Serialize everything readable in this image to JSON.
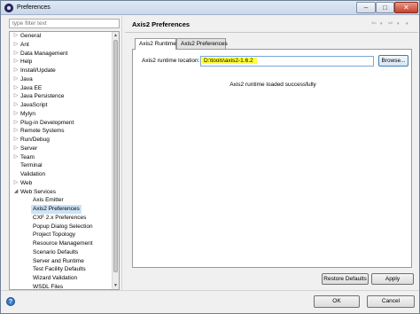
{
  "window": {
    "title": "Preferences",
    "app_icon": "eclipse-icon",
    "controls": {
      "minimize": "–",
      "maximize": "□",
      "close": "✕"
    }
  },
  "filter": {
    "placeholder": "type filter text"
  },
  "tree": {
    "items": [
      {
        "label": "General",
        "expander": "collapsed",
        "depth": 0
      },
      {
        "label": "Ant",
        "expander": "collapsed",
        "depth": 0
      },
      {
        "label": "Data Management",
        "expander": "collapsed",
        "depth": 0
      },
      {
        "label": "Help",
        "expander": "collapsed",
        "depth": 0
      },
      {
        "label": "Install/Update",
        "expander": "collapsed",
        "depth": 0
      },
      {
        "label": "Java",
        "expander": "collapsed",
        "depth": 0
      },
      {
        "label": "Java EE",
        "expander": "collapsed",
        "depth": 0
      },
      {
        "label": "Java Persistence",
        "expander": "collapsed",
        "depth": 0
      },
      {
        "label": "JavaScript",
        "expander": "collapsed",
        "depth": 0
      },
      {
        "label": "Mylyn",
        "expander": "collapsed",
        "depth": 0
      },
      {
        "label": "Plug-in Development",
        "expander": "collapsed",
        "depth": 0
      },
      {
        "label": "Remote Systems",
        "expander": "collapsed",
        "depth": 0
      },
      {
        "label": "Run/Debug",
        "expander": "collapsed",
        "depth": 0
      },
      {
        "label": "Server",
        "expander": "collapsed",
        "depth": 0
      },
      {
        "label": "Team",
        "expander": "collapsed",
        "depth": 0
      },
      {
        "label": "Terminal",
        "expander": "none",
        "depth": 0
      },
      {
        "label": "Validation",
        "expander": "none",
        "depth": 0
      },
      {
        "label": "Web",
        "expander": "collapsed",
        "depth": 0
      },
      {
        "label": "Web Services",
        "expander": "expanded",
        "depth": 0
      },
      {
        "label": "Axis Emitter",
        "expander": "none",
        "depth": 1
      },
      {
        "label": "Axis2 Preferences",
        "expander": "none",
        "depth": 1,
        "selected": true
      },
      {
        "label": "CXF 2.x Preferences",
        "expander": "none",
        "depth": 1
      },
      {
        "label": "Popup Dialog Selection",
        "expander": "none",
        "depth": 1
      },
      {
        "label": "Project Topology",
        "expander": "none",
        "depth": 1
      },
      {
        "label": "Resource Management",
        "expander": "none",
        "depth": 1
      },
      {
        "label": "Scenario Defaults",
        "expander": "none",
        "depth": 1
      },
      {
        "label": "Server and Runtime",
        "expander": "none",
        "depth": 1
      },
      {
        "label": "Test Facility Defaults",
        "expander": "none",
        "depth": 1
      },
      {
        "label": "Wizard Validation",
        "expander": "none",
        "depth": 1
      },
      {
        "label": "WSDL Files",
        "expander": "none",
        "depth": 1
      }
    ]
  },
  "page": {
    "title": "Axis2 Preferences",
    "nav": {
      "back": "⇦",
      "back_menu": "▾",
      "forward": "⇨",
      "forward_menu": "▾",
      "menu": "▾"
    },
    "tabs": [
      {
        "label": "Axis2 Runtime",
        "active": true
      },
      {
        "label": "Axis2 Preferences",
        "active": false
      }
    ],
    "runtime": {
      "location_label": "Axis2 runtime location:",
      "location_value": "D:\\tools\\axis2-1.6.2",
      "highlight_color": "#ffff3a",
      "browse_label": "Browse...",
      "status_message": "Axis2 runtime loaded successfully"
    },
    "restore_defaults_label": "Restore Defaults",
    "apply_label": "Apply"
  },
  "dialog": {
    "help_icon": "help-icon",
    "help_glyph": "?",
    "ok_label": "OK",
    "cancel_label": "Cancel"
  }
}
